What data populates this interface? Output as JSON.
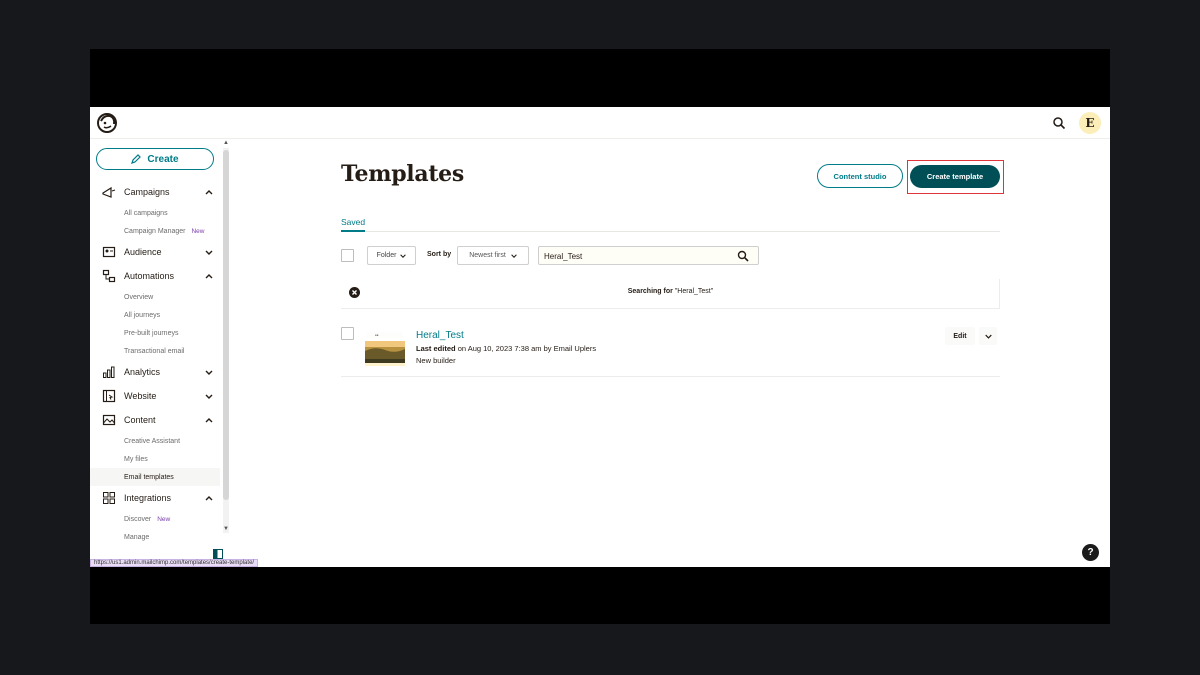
{
  "topbar": {
    "logo_icon": "mailchimp-freddie-logo",
    "search_icon": "search-icon",
    "avatar_initial": "E"
  },
  "sidebar": {
    "create_label": "Create",
    "sections": [
      {
        "label": "Campaigns",
        "icon": "megaphone-icon",
        "expanded": true,
        "children": [
          {
            "label": "All campaigns"
          },
          {
            "label": "Campaign Manager",
            "badge": "New"
          }
        ]
      },
      {
        "label": "Audience",
        "icon": "audience-icon",
        "expanded": false,
        "children": []
      },
      {
        "label": "Automations",
        "icon": "automations-icon",
        "expanded": true,
        "children": [
          {
            "label": "Overview"
          },
          {
            "label": "All journeys"
          },
          {
            "label": "Pre-built journeys"
          },
          {
            "label": "Transactional email"
          }
        ]
      },
      {
        "label": "Analytics",
        "icon": "analytics-icon",
        "expanded": false,
        "children": []
      },
      {
        "label": "Website",
        "icon": "website-icon",
        "expanded": false,
        "children": []
      },
      {
        "label": "Content",
        "icon": "content-icon",
        "expanded": true,
        "children": [
          {
            "label": "Creative Assistant"
          },
          {
            "label": "My files"
          },
          {
            "label": "Email templates",
            "active": true
          }
        ]
      },
      {
        "label": "Integrations",
        "icon": "integrations-icon",
        "expanded": true,
        "children": [
          {
            "label": "Discover",
            "badge": "New"
          },
          {
            "label": "Manage"
          }
        ]
      }
    ]
  },
  "status_url": "https://us1.admin.mailchimp.com/templates/create-template/",
  "main": {
    "title": "Templates",
    "content_studio_label": "Content studio",
    "create_template_label": "Create template",
    "tab_saved": "Saved",
    "folder_label": "Folder",
    "sort_by_label": "Sort by",
    "sort_value": "Newest first",
    "search_value": "Heral_Test",
    "searching_prefix": "Searching for",
    "searching_query": "\"Heral_Test\""
  },
  "templates": [
    {
      "name": "Heral_Test",
      "meta_bold": "Last edited",
      "meta_rest": "on Aug 10, 2023 7:38 am by Email Uplers",
      "builder": "New builder",
      "edit_label": "Edit"
    }
  ],
  "colors": {
    "accent": "#007c89",
    "primary_button": "#004e56",
    "highlight": "#e0343a",
    "badge": "#7a3ea8"
  }
}
